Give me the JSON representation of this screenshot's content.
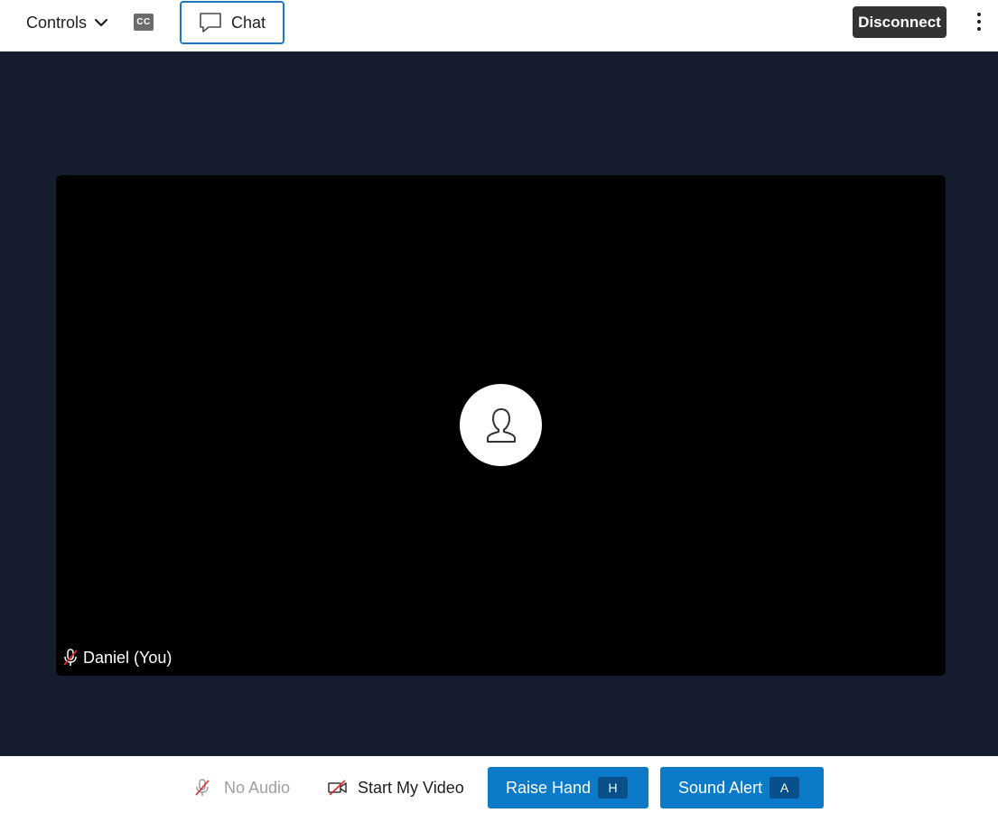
{
  "topbar": {
    "controls_label": "Controls",
    "cc_label": "CC",
    "chat_label": "Chat",
    "disconnect_label": "Disconnect"
  },
  "video": {
    "participant_name": "Daniel (You)"
  },
  "bottombar": {
    "no_audio_label": "No Audio",
    "start_video_label": "Start My Video",
    "raise_hand_label": "Raise Hand",
    "raise_hand_shortcut": "H",
    "sound_alert_label": "Sound Alert",
    "sound_alert_shortcut": "A"
  },
  "colors": {
    "stage_bg": "#141c2d",
    "accent_blue": "#0b7ac8",
    "disconnect_bg": "#333333",
    "muted_red": "#e0262b"
  },
  "icons": {
    "controls_chevron": "chevron-down-icon",
    "chat": "speech-bubble-icon",
    "more": "vertical-dots-icon",
    "avatar": "user-icon",
    "mic_off": "mic-off-icon",
    "video_off": "video-off-icon"
  }
}
